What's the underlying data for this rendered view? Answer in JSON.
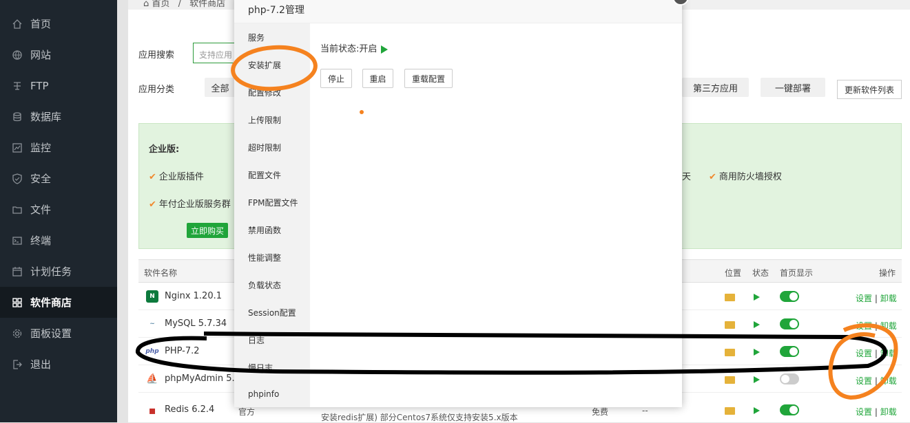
{
  "sidebar": {
    "items": [
      {
        "label": "首页",
        "icon": "home-icon"
      },
      {
        "label": "网站",
        "icon": "globe-icon"
      },
      {
        "label": "FTP",
        "icon": "ftp-icon"
      },
      {
        "label": "数据库",
        "icon": "database-icon"
      },
      {
        "label": "监控",
        "icon": "monitor-icon"
      },
      {
        "label": "安全",
        "icon": "shield-icon"
      },
      {
        "label": "文件",
        "icon": "folder-icon"
      },
      {
        "label": "终端",
        "icon": "terminal-icon"
      },
      {
        "label": "计划任务",
        "icon": "calendar-icon"
      },
      {
        "label": "软件商店",
        "icon": "grid-icon",
        "active": true
      },
      {
        "label": "面板设置",
        "icon": "gear-icon"
      },
      {
        "label": "退出",
        "icon": "logout-icon"
      }
    ]
  },
  "breadcrumb": {
    "home": "首页",
    "sep": "/",
    "current": "软件商店"
  },
  "search": {
    "label": "应用搜索",
    "placeholder": "支持应用"
  },
  "category": {
    "label": "应用分类",
    "all": "全部",
    "third_party": "第三方应用",
    "one_click": "一键部署",
    "refresh": "更新软件列表"
  },
  "enterprise": {
    "title": "企业版:",
    "features": [
      "企业版插件",
      "年付企业版服务群",
      "天",
      "商用防火墙授权"
    ],
    "buy": "立即购买"
  },
  "table": {
    "headers": {
      "name": "软件名称",
      "location": "位置",
      "status": "状态",
      "homepage": "首页显示",
      "ops": "操作"
    },
    "rows": [
      {
        "name": "Nginx 1.20.1",
        "icon_text": "N",
        "toggle": true
      },
      {
        "name": "MySQL 5.7.34",
        "icon_text": "~",
        "toggle": true
      },
      {
        "name": "PHP-7.2",
        "icon_text": "php",
        "toggle": true
      },
      {
        "name": "phpMyAdmin 5.0",
        "icon_text": "⛵",
        "toggle": false
      },
      {
        "name": "Redis 6.2.4",
        "icon_text": "▪",
        "toggle": true
      }
    ],
    "ops_set": "设置",
    "ops_sep": "|",
    "ops_uninstall": "卸载",
    "redis_dev": "官方",
    "redis_price": "免费",
    "redis_expire": "--",
    "redis_desc": "安装redis扩展) 部分Centos7系统仅支持安装5.x版本"
  },
  "modal": {
    "title": "php-7.2管理",
    "nav": [
      "服务",
      "安装扩展",
      "配置修改",
      "上传限制",
      "超时限制",
      "配置文件",
      "FPM配置文件",
      "禁用函数",
      "性能调整",
      "负载状态",
      "Session配置",
      "日志",
      "慢日志",
      "phpinfo"
    ],
    "status_label": "当前状态:开启",
    "buttons": {
      "stop": "停止",
      "restart": "重启",
      "reload": "重载配置"
    }
  },
  "colors": {
    "accent": "#20a53a",
    "sidebar_bg": "#1e262e",
    "annotation_orange": "#f5821f",
    "annotation_black": "#000000"
  }
}
